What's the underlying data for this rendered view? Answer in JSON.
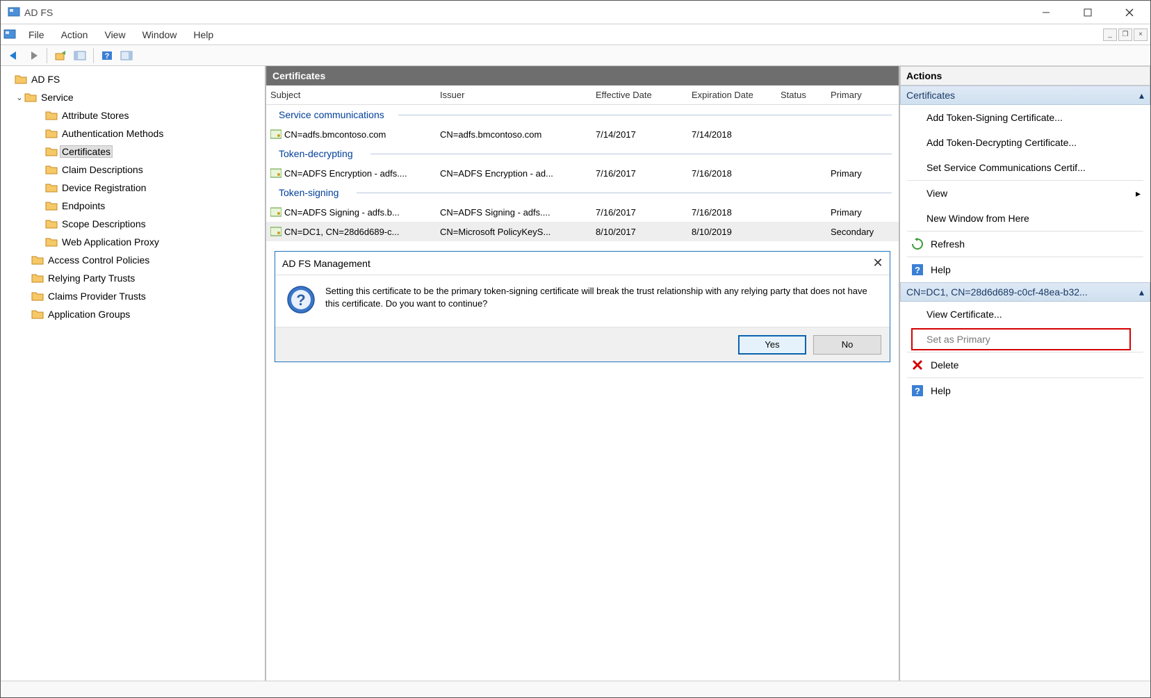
{
  "window": {
    "title": "AD FS"
  },
  "menu": {
    "file": "File",
    "action": "Action",
    "view": "View",
    "window": "Window",
    "help": "Help"
  },
  "tree": {
    "root": "AD FS",
    "service": "Service",
    "service_children": {
      "attribute_stores": "Attribute Stores",
      "auth_methods": "Authentication Methods",
      "certificates": "Certificates",
      "claim_descriptions": "Claim Descriptions",
      "device_registration": "Device Registration",
      "endpoints": "Endpoints",
      "scope_descriptions": "Scope Descriptions",
      "web_app_proxy": "Web Application Proxy"
    },
    "siblings": {
      "acp": "Access Control Policies",
      "rpt": "Relying Party Trusts",
      "cpt": "Claims Provider Trusts",
      "ag": "Application Groups"
    }
  },
  "center": {
    "title": "Certificates",
    "columns": {
      "subject": "Subject",
      "issuer": "Issuer",
      "effective": "Effective Date",
      "expiration": "Expiration Date",
      "status": "Status",
      "primary": "Primary"
    },
    "groups": {
      "service_comm": "Service communications",
      "token_decrypting": "Token-decrypting",
      "token_signing": "Token-signing"
    },
    "rows": {
      "r1": {
        "subject": "CN=adfs.bmcontoso.com",
        "issuer": "CN=adfs.bmcontoso.com",
        "effective": "7/14/2017",
        "expiration": "7/14/2018",
        "status": "",
        "primary": ""
      },
      "r2": {
        "subject": "CN=ADFS Encryption - adfs....",
        "issuer": "CN=ADFS Encryption - ad...",
        "effective": "7/16/2017",
        "expiration": "7/16/2018",
        "status": "",
        "primary": "Primary"
      },
      "r3": {
        "subject": "CN=ADFS Signing - adfs.b...",
        "issuer": "CN=ADFS Signing - adfs....",
        "effective": "7/16/2017",
        "expiration": "7/16/2018",
        "status": "",
        "primary": "Primary"
      },
      "r4": {
        "subject": "CN=DC1, CN=28d6d689-c...",
        "issuer": "CN=Microsoft PolicyKeyS...",
        "effective": "8/10/2017",
        "expiration": "8/10/2019",
        "status": "",
        "primary": "Secondary"
      }
    }
  },
  "dialog": {
    "title": "AD FS Management",
    "message": "Setting this certificate to be the primary token-signing certificate will break the trust relationship with any relying party that does not have this certificate.  Do you want to continue?",
    "yes": "Yes",
    "no": "No"
  },
  "actions": {
    "header": "Actions",
    "section1": "Certificates",
    "items1": {
      "add_ts": "Add Token-Signing Certificate...",
      "add_td": "Add Token-Decrypting Certificate...",
      "set_sc": "Set Service Communications Certif...",
      "view": "View",
      "new_window": "New Window from Here",
      "refresh": "Refresh",
      "help": "Help"
    },
    "section2": "CN=DC1, CN=28d6d689-c0cf-48ea-b32...",
    "items2": {
      "view_cert": "View Certificate...",
      "set_primary": "Set as Primary",
      "delete": "Delete",
      "help": "Help"
    }
  }
}
